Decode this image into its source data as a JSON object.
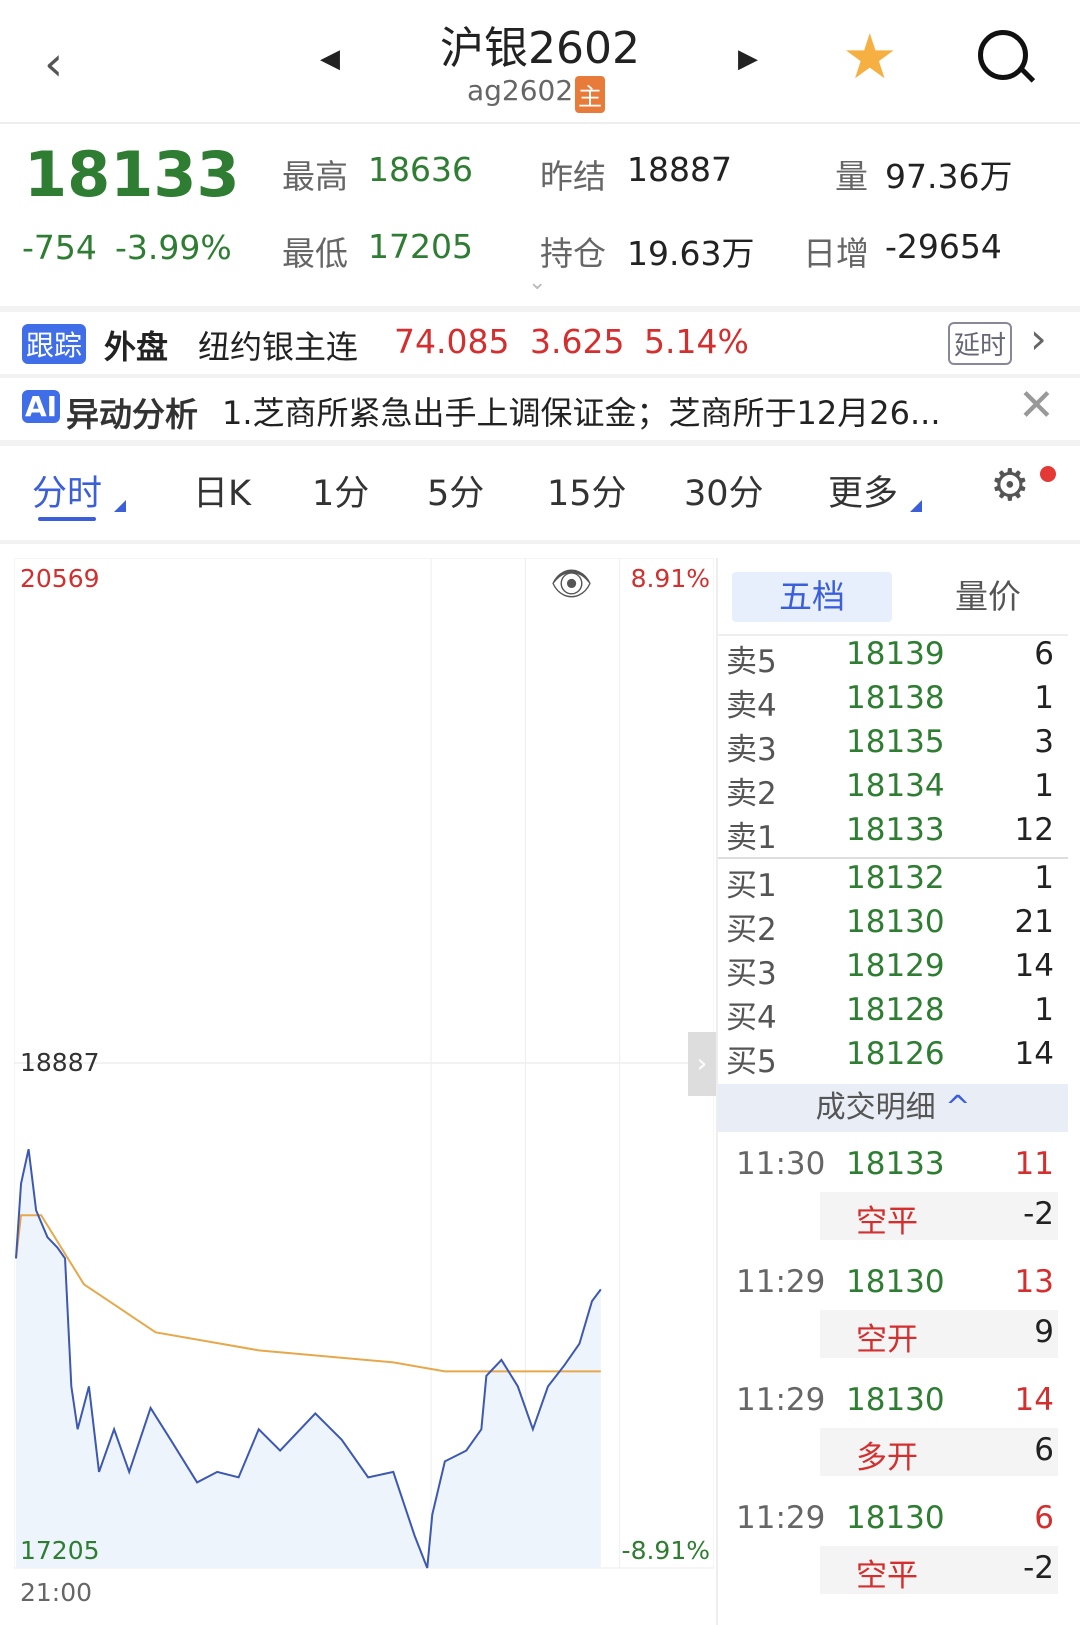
{
  "header": {
    "title": "沪银2602",
    "code": "ag2602",
    "badge": "主"
  },
  "quote": {
    "price": "18133",
    "change": "-754",
    "change_pct": "-3.99%",
    "high_label": "最高",
    "high": "18636",
    "low_label": "最低",
    "low": "17205",
    "prev_label": "昨结",
    "prev": "18887",
    "oi_label": "持仓",
    "oi": "19.63万",
    "vol_label": "量",
    "vol": "97.36万",
    "inc_label": "日增",
    "inc": "-29654"
  },
  "foreign": {
    "tag": "跟踪",
    "title": "外盘",
    "name": "纽约银主连",
    "price": "74.085",
    "change": "3.625",
    "pct": "5.14%",
    "delay": "延时"
  },
  "ai": {
    "tag": "AI",
    "title": "异动分析",
    "text": "1.芝商所紧急出手上调保证金；芝商所于12月26..."
  },
  "tabs": [
    "分时",
    "日K",
    "1分",
    "5分",
    "15分",
    "30分",
    "更多"
  ],
  "chart_data": {
    "type": "line",
    "y_top": "20569",
    "y_mid": "18887",
    "y_bottom": "17205",
    "pct_top": "8.91%",
    "pct_bottom": "-8.91%",
    "x_start": "21:00",
    "ylim": [
      17205,
      20569
    ],
    "total_minutes": 555,
    "price": [
      [
        0,
        18236
      ],
      [
        4,
        18485
      ],
      [
        10,
        18600
      ],
      [
        16,
        18396
      ],
      [
        25,
        18307
      ],
      [
        33,
        18272
      ],
      [
        39,
        18236
      ],
      [
        44,
        17810
      ],
      [
        49,
        17667
      ],
      [
        58,
        17810
      ],
      [
        66,
        17525
      ],
      [
        78,
        17667
      ],
      [
        90,
        17525
      ],
      [
        107,
        17738
      ],
      [
        123,
        17632
      ],
      [
        144,
        17490
      ],
      [
        160,
        17525
      ],
      [
        177,
        17507
      ],
      [
        193,
        17667
      ],
      [
        210,
        17596
      ],
      [
        238,
        17720
      ],
      [
        259,
        17632
      ],
      [
        280,
        17507
      ],
      [
        300,
        17525
      ],
      [
        317,
        17312
      ],
      [
        327,
        17205
      ],
      [
        331,
        17383
      ],
      [
        341,
        17560
      ],
      [
        358,
        17596
      ],
      [
        370,
        17667
      ],
      [
        374,
        17845
      ],
      [
        386,
        17898
      ],
      [
        399,
        17810
      ],
      [
        411,
        17667
      ],
      [
        423,
        17810
      ],
      [
        436,
        17880
      ],
      [
        448,
        17952
      ],
      [
        458,
        18094
      ],
      [
        465,
        18133
      ]
    ],
    "avg": [
      [
        0,
        18236
      ],
      [
        4,
        18380
      ],
      [
        20,
        18380
      ],
      [
        54,
        18150
      ],
      [
        111,
        17990
      ],
      [
        193,
        17930
      ],
      [
        300,
        17890
      ],
      [
        341,
        17860
      ],
      [
        465,
        17860
      ]
    ]
  },
  "orderbook": {
    "tabs": [
      "五档",
      "量价"
    ],
    "asks": [
      {
        "label": "卖5",
        "price": "18139",
        "vol": "6"
      },
      {
        "label": "卖4",
        "price": "18138",
        "vol": "1"
      },
      {
        "label": "卖3",
        "price": "18135",
        "vol": "3"
      },
      {
        "label": "卖2",
        "price": "18134",
        "vol": "1"
      },
      {
        "label": "卖1",
        "price": "18133",
        "vol": "12"
      }
    ],
    "bids": [
      {
        "label": "买1",
        "price": "18132",
        "vol": "1"
      },
      {
        "label": "买2",
        "price": "18130",
        "vol": "21"
      },
      {
        "label": "买3",
        "price": "18129",
        "vol": "14"
      },
      {
        "label": "买4",
        "price": "18128",
        "vol": "1"
      },
      {
        "label": "买5",
        "price": "18126",
        "vol": "14"
      }
    ]
  },
  "trades": {
    "title": "成交明细",
    "items": [
      {
        "time": "11:30",
        "price": "18133",
        "vol": "11",
        "type": "空平",
        "chg": "-2"
      },
      {
        "time": "11:29",
        "price": "18130",
        "vol": "13",
        "type": "空开",
        "chg": "9"
      },
      {
        "time": "11:29",
        "price": "18130",
        "vol": "14",
        "type": "多开",
        "chg": "6"
      },
      {
        "time": "11:29",
        "price": "18130",
        "vol": "6",
        "type": "空平",
        "chg": "-2"
      }
    ]
  }
}
